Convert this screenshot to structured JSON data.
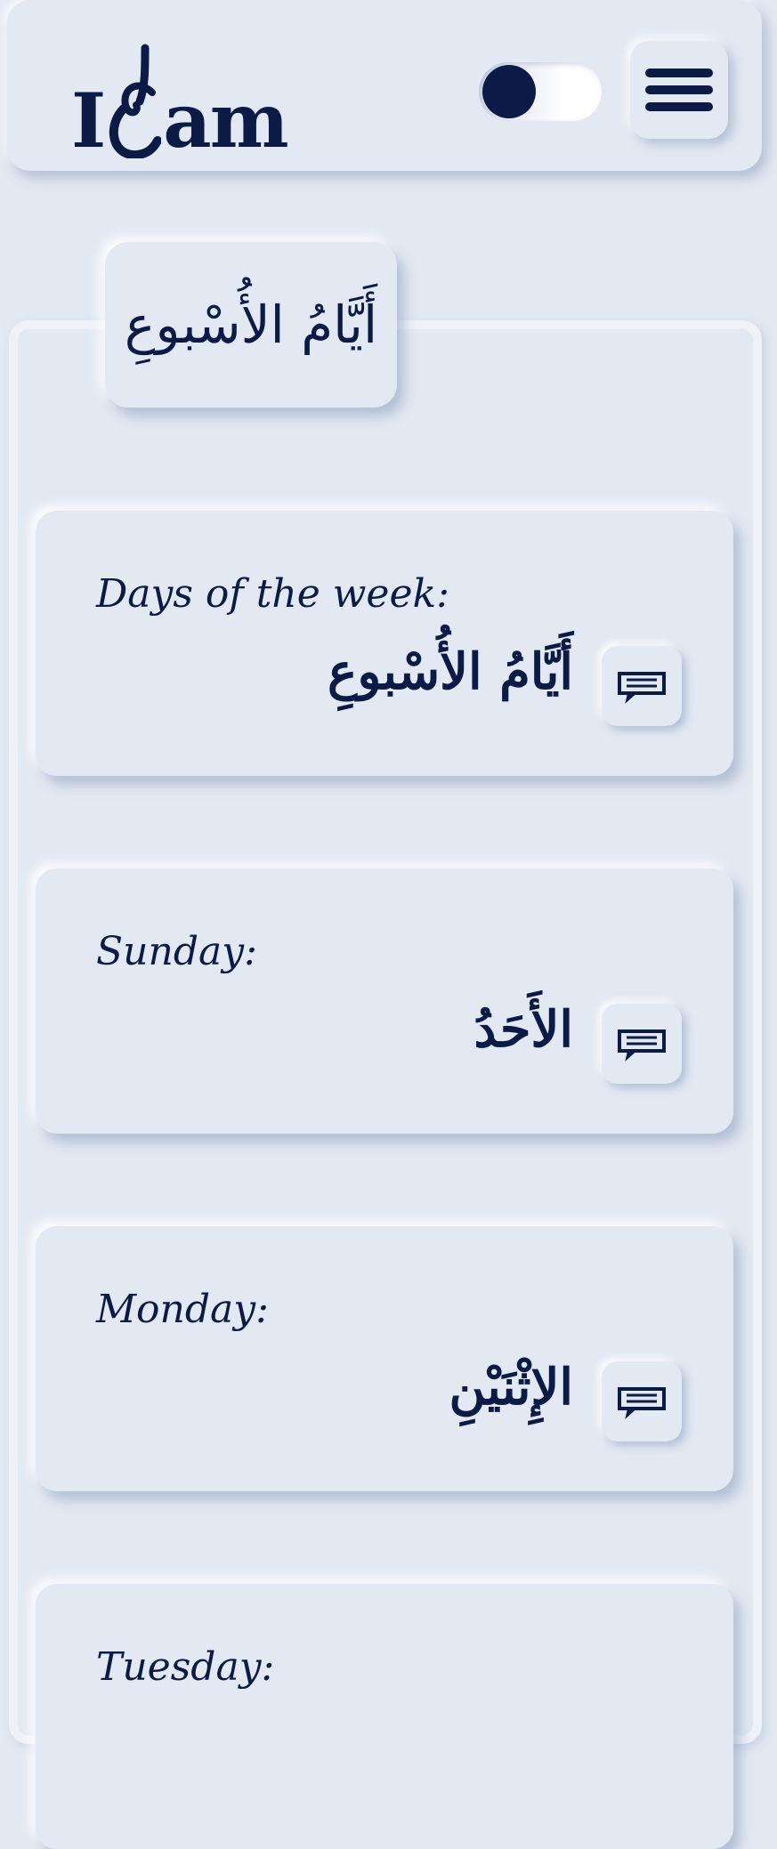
{
  "header": {
    "logo_left": "I",
    "logo_right": "am",
    "toggle_state": "off",
    "menu_icon": "hamburger-icon"
  },
  "section": {
    "title": "أَيَّامُ الأُسْبوعِ"
  },
  "cards": [
    {
      "english": "Days of the week:",
      "arabic": "أَيَّامُ الأُسْبوعِ",
      "icon": "speech-bubble-icon"
    },
    {
      "english": "Sunday:",
      "arabic": "الأَحَدُ",
      "icon": "speech-bubble-icon"
    },
    {
      "english": "Monday:",
      "arabic": "الإِثْنَيْنِ",
      "icon": "speech-bubble-icon"
    },
    {
      "english": "Tuesday:",
      "arabic": "",
      "icon": "speech-bubble-icon"
    }
  ],
  "colors": {
    "background": "#e3e9f2",
    "primary": "#0b1b45",
    "accent_orange": "#ef8c2c",
    "accent_red": "#d8313a"
  }
}
